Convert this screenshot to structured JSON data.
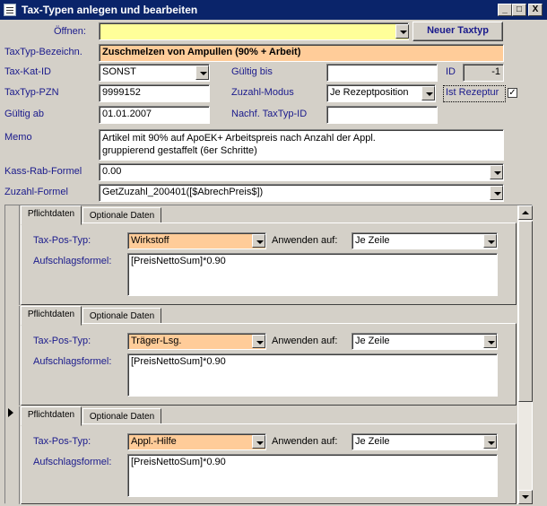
{
  "window": {
    "title": "Tax-Typen anlegen und bearbeiten",
    "min": "_",
    "max": "□",
    "close": "X"
  },
  "top": {
    "open_label": "Öffnen:",
    "open_value": "",
    "new_button": "Neuer Taxtyp"
  },
  "form": {
    "bezeichnung_label": "TaxTyp-Bezeichn.",
    "bezeichnung_value": "Zuschmelzen von Ampullen (90% + Arbeit)",
    "katid_label": "Tax-Kat-ID",
    "katid_value": "SONST",
    "gueltig_bis_label": "Gültig bis",
    "gueltig_bis_value": "",
    "id_label": "ID",
    "id_value": "-1",
    "pzn_label": "TaxTyp-PZN",
    "pzn_value": "9999152",
    "zuzahl_modus_label": "Zuzahl-Modus",
    "zuzahl_modus_value": "Je Rezeptposition",
    "ist_rezeptur_label": "Ist Rezeptur",
    "ist_rezeptur_checked": "✓",
    "gueltig_ab_label": "Gültig ab",
    "gueltig_ab_value": "01.01.2007",
    "nachf_label": "Nachf. TaxTyp-ID",
    "nachf_value": "",
    "memo_label": "Memo",
    "memo_value": "Artikel mit 90% auf ApoEK+ Arbeitspreis nach Anzahl der Appl.\ngruppierend gestaffelt (6er Schritte)",
    "kass_label": "Kass-Rab-Formel",
    "kass_value": "0.00",
    "zuzahl_formel_label": "Zuzahl-Formel",
    "zuzahl_formel_value": "GetZuzahl_200401([$AbrechPreis$])"
  },
  "records": [
    {
      "tab1": "Pflichtdaten",
      "tab2": "Optionale Daten",
      "pos_typ_label": "Tax-Pos-Typ:",
      "pos_typ_value": "Wirkstoff",
      "anwenden_label": "Anwenden auf:",
      "anwenden_value": "Je Zeile",
      "aufschlag_label": "Aufschlagsformel:",
      "aufschlag_value": "[PreisNettoSum]*0.90"
    },
    {
      "tab1": "Pflichtdaten",
      "tab2": "Optionale Daten",
      "pos_typ_label": "Tax-Pos-Typ:",
      "pos_typ_value": "Träger-Lsg.",
      "anwenden_label": "Anwenden auf:",
      "anwenden_value": "Je Zeile",
      "aufschlag_label": "Aufschlagsformel:",
      "aufschlag_value": "[PreisNettoSum]*0.90"
    },
    {
      "tab1": "Pflichtdaten",
      "tab2": "Optionale Daten",
      "pos_typ_label": "Tax-Pos-Typ:",
      "pos_typ_value": "Appl.-Hilfe",
      "anwenden_label": "Anwenden auf:",
      "anwenden_value": "Je Zeile",
      "aufschlag_label": "Aufschlagsformel:",
      "aufschlag_value": "[PreisNettoSum]*0.90"
    }
  ],
  "colors": {
    "title_bar": "#0a246a",
    "highlight_yellow": "#ffff99",
    "highlight_orange": "#ffcc99",
    "label_blue": "#1a1a8c"
  },
  "icons": [
    "window-icon",
    "minimize-icon",
    "maximize-icon",
    "close-icon",
    "dropdown-arrow-icon",
    "record-pointer-icon",
    "scroll-up-icon",
    "scroll-down-icon"
  ]
}
